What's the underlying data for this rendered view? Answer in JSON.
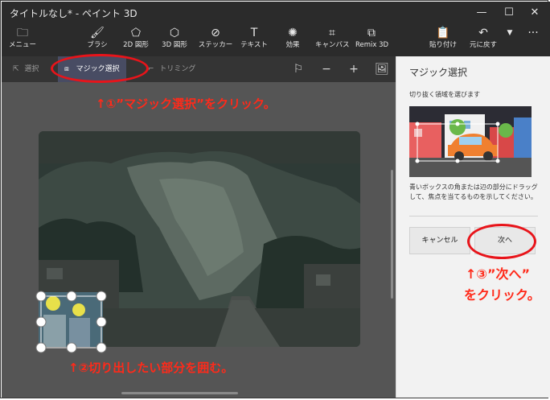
{
  "window": {
    "title": "タイトルなし* - ペイント 3D",
    "minimize": "—",
    "maximize": "☐",
    "close": "✕"
  },
  "toolbar": {
    "menu": "メニュー",
    "brush": "ブラシ",
    "shapes2d": "2D 図形",
    "shapes3d": "3D 図形",
    "stickers": "ステッカー",
    "text": "テキスト",
    "effects": "効果",
    "canvas": "キャンバス",
    "remix": "Remix 3D",
    "paste": "貼り付け",
    "undo": "元に戻す",
    "more": "···"
  },
  "subtoolbar": {
    "select": "選択",
    "magic_select": "マジック選択",
    "crop": "トリミング"
  },
  "panel": {
    "title": "マジック選択",
    "subtitle": "切り抜く領域を選びます",
    "description": "青いボックスの角または辺の部分にドラッグして、焦点を当てるものを示してください。",
    "cancel": "キャンセル",
    "next": "次へ"
  },
  "annotations": {
    "step1": "↑①”マジック選択”をクリック。",
    "step2": "↑②切り出したい部分を囲む。",
    "step3_line1": "↑③”次へ”",
    "step3_line2": "をクリック。"
  },
  "colors": {
    "accent": "#e8141a",
    "toolbar_bg": "#2b2b2b",
    "canvas_bg": "#555555",
    "panel_bg": "#f2f2f2"
  }
}
